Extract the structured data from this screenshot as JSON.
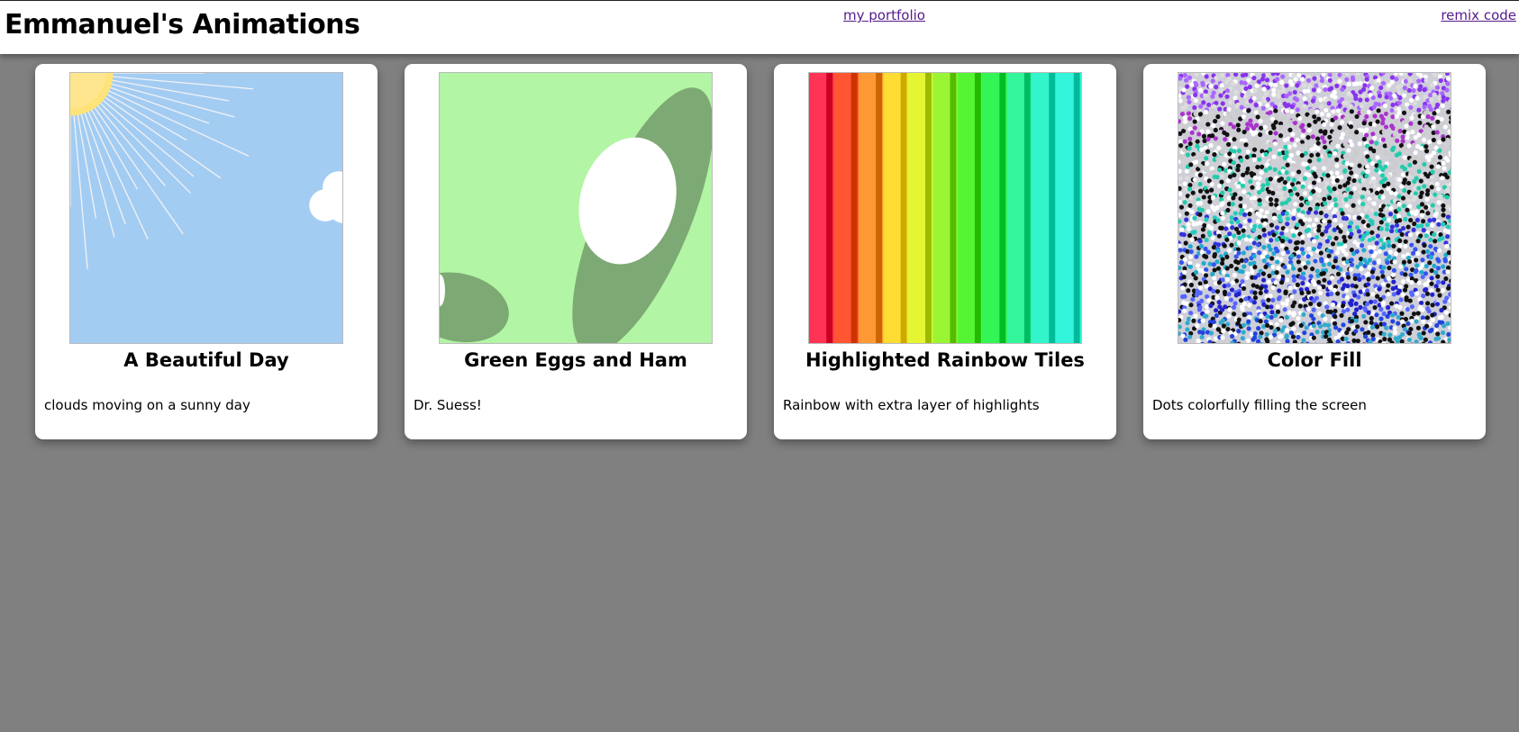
{
  "header": {
    "title": "Emmanuel's Animations",
    "links": [
      {
        "label": "my portfolio"
      },
      {
        "label": "remix code"
      }
    ]
  },
  "cards": [
    {
      "title": "A Beautiful Day",
      "description": "clouds moving on a sunny day",
      "thumbnail_icon": "sunny-sky-icon"
    },
    {
      "title": "Green Eggs and Ham",
      "description": "Dr. Suess!",
      "thumbnail_icon": "green-eggs-icon"
    },
    {
      "title": "Highlighted Rainbow Tiles",
      "description": "Rainbow with extra layer of highlights",
      "thumbnail_icon": "rainbow-tiles-icon"
    },
    {
      "title": "Color Fill",
      "description": "Dots colorfully filling the screen",
      "thumbnail_icon": "color-dots-icon"
    }
  ],
  "colors": {
    "background": "#808080",
    "card": "#ffffff",
    "link": "#551a8b",
    "sky": "#a3ccf3",
    "sun": "#fde37a",
    "egg_background": "#b2f5a4",
    "egg_green": "#7da974"
  }
}
